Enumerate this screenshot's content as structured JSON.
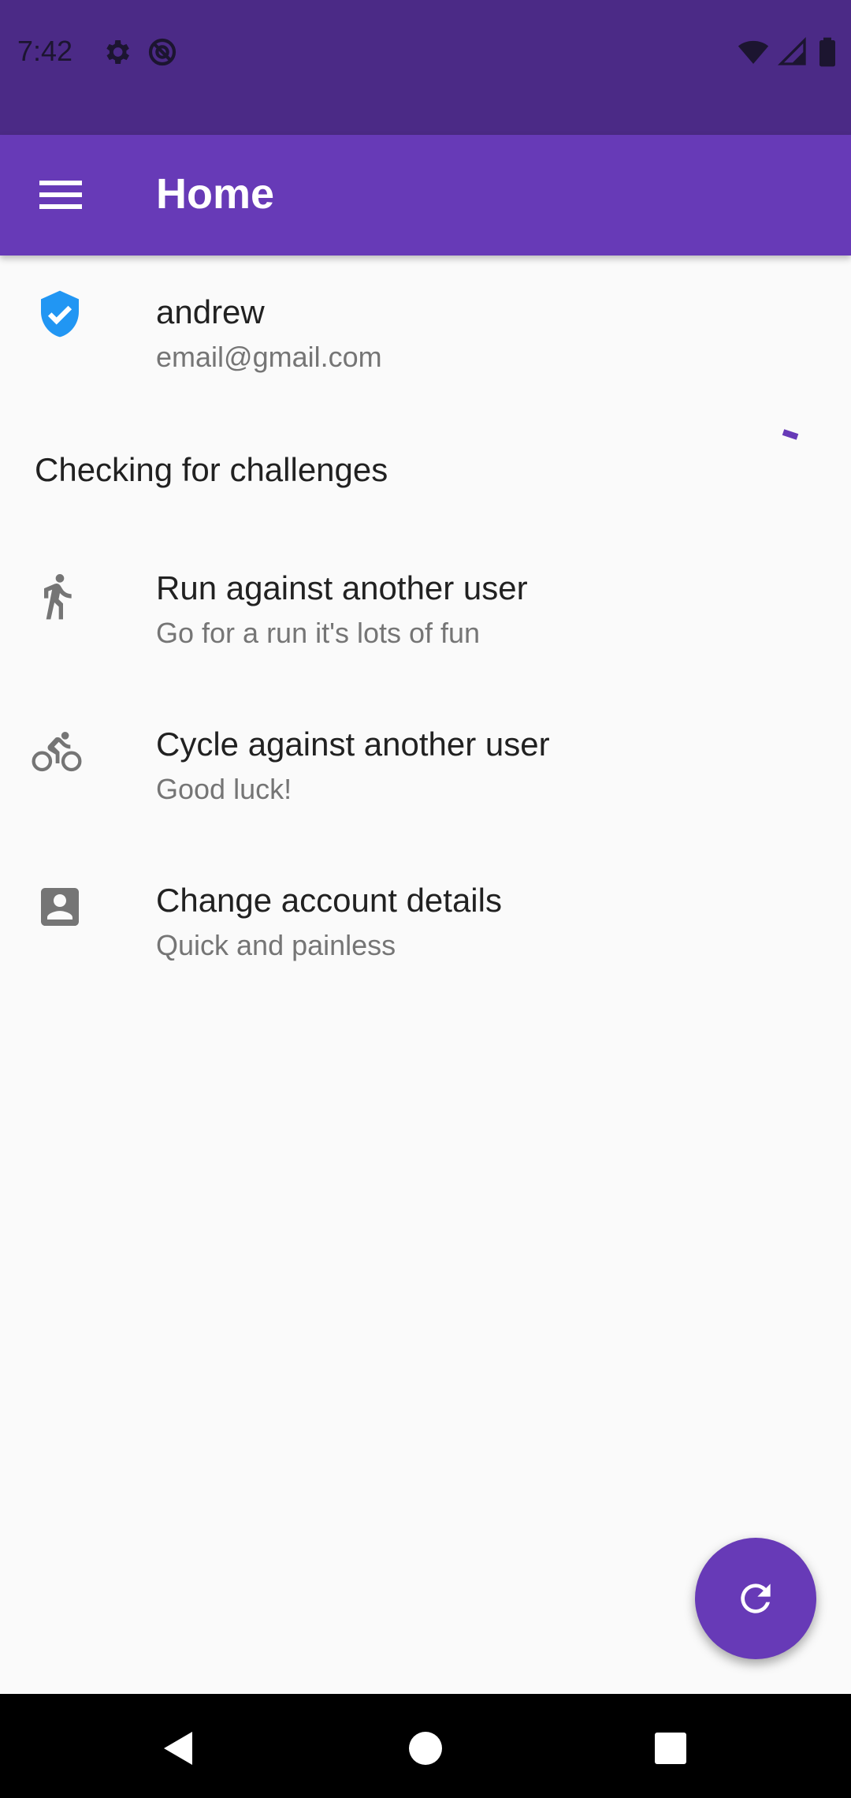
{
  "status_bar": {
    "time": "7:42",
    "left_icons": [
      "gear-icon",
      "sync-disabled-icon"
    ],
    "right_icons": [
      "wifi-icon",
      "signal-icon",
      "battery-icon"
    ]
  },
  "app_bar": {
    "title": "Home",
    "menu_icon": "hamburger-menu-icon",
    "color": "#673ab7"
  },
  "user": {
    "name": "andrew",
    "email": "email@gmail.com",
    "icon": "verified-shield-icon"
  },
  "challenges_status": {
    "label": "Checking for challenges"
  },
  "menu_items": [
    {
      "title": "Run against another user",
      "subtitle": "Go for a run it's lots of fun",
      "icon": "run-icon"
    },
    {
      "title": "Cycle against another user",
      "subtitle": "Good luck!",
      "icon": "bike-icon"
    },
    {
      "title": "Change account details",
      "subtitle": "Quick and painless",
      "icon": "account-box-icon"
    }
  ],
  "fab": {
    "icon": "refresh-icon"
  },
  "nav_bar": {
    "icons": [
      "back-icon",
      "home-icon",
      "recents-icon"
    ]
  },
  "colors": {
    "accent": "#673ab7",
    "status_bar": "#4b2a86",
    "shield": "#2196f3"
  }
}
